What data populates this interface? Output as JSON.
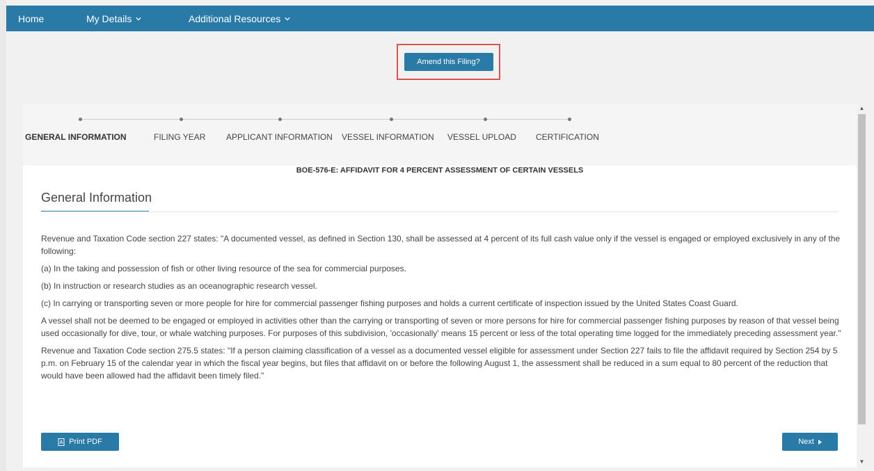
{
  "nav": {
    "home": "Home",
    "my_details": "My Details",
    "additional_resources": "Additional Resources"
  },
  "amend_button": "Amend this Filing?",
  "steps": [
    {
      "label": "GENERAL INFORMATION",
      "active": true
    },
    {
      "label": "FILING YEAR",
      "active": false
    },
    {
      "label": "APPLICANT INFORMATION",
      "active": false
    },
    {
      "label": "VESSEL INFORMATION",
      "active": false
    },
    {
      "label": "VESSEL UPLOAD",
      "active": false
    },
    {
      "label": "CERTIFICATION",
      "active": false
    }
  ],
  "form_title": "BOE-576-E: AFFIDAVIT FOR 4 PERCENT ASSESSMENT OF CERTAIN VESSELS",
  "section_title": "General Information",
  "paragraphs": [
    "Revenue and Taxation Code section 227 states: \"A documented vessel, as defined in Section 130, shall be assessed at 4 percent of its full cash value only if the vessel is engaged or employed exclusively in any of the following:",
    "(a) In the taking and possession of fish or other living resource of the sea for commercial purposes.",
    "(b) In instruction or research studies as an oceanographic research vessel.",
    "(c) In carrying or transporting seven or more people for hire for commercial passenger fishing purposes and holds a current certificate of inspection issued by the United States Coast Guard.",
    "A vessel shall not be deemed to be engaged or employed in activities other than the carrying or transporting of seven or more persons for hire for commercial passenger fishing purposes by reason of that vessel being used occasionally for dive, tour, or whale watching purposes. For purposes of this subdivision, 'occasionally' means 15 percent or less of the total operating time logged for the immediately preceding assessment year.\"",
    "Revenue and Taxation Code section 275.5 states: \"If a person claiming classification of a vessel as a documented vessel eligible for assessment under Section 227 fails to file the affidavit required by Section 254 by 5 p.m. on February 15 of the calendar year in which the fiscal year begins, but files that affidavit on or before the following August 1, the assessment shall be reduced in a sum equal to 80 percent of the reduction that would have been allowed had the affidavit been timely filed.\""
  ],
  "buttons": {
    "print_pdf": "Print PDF",
    "next": "Next"
  },
  "icons": {
    "nav_dropdown": "chevron-down-icon",
    "print": "pdf-icon",
    "next": "caret-right-icon"
  },
  "colors": {
    "primary": "#2a7aa8",
    "highlight_border": "#d9534f"
  }
}
